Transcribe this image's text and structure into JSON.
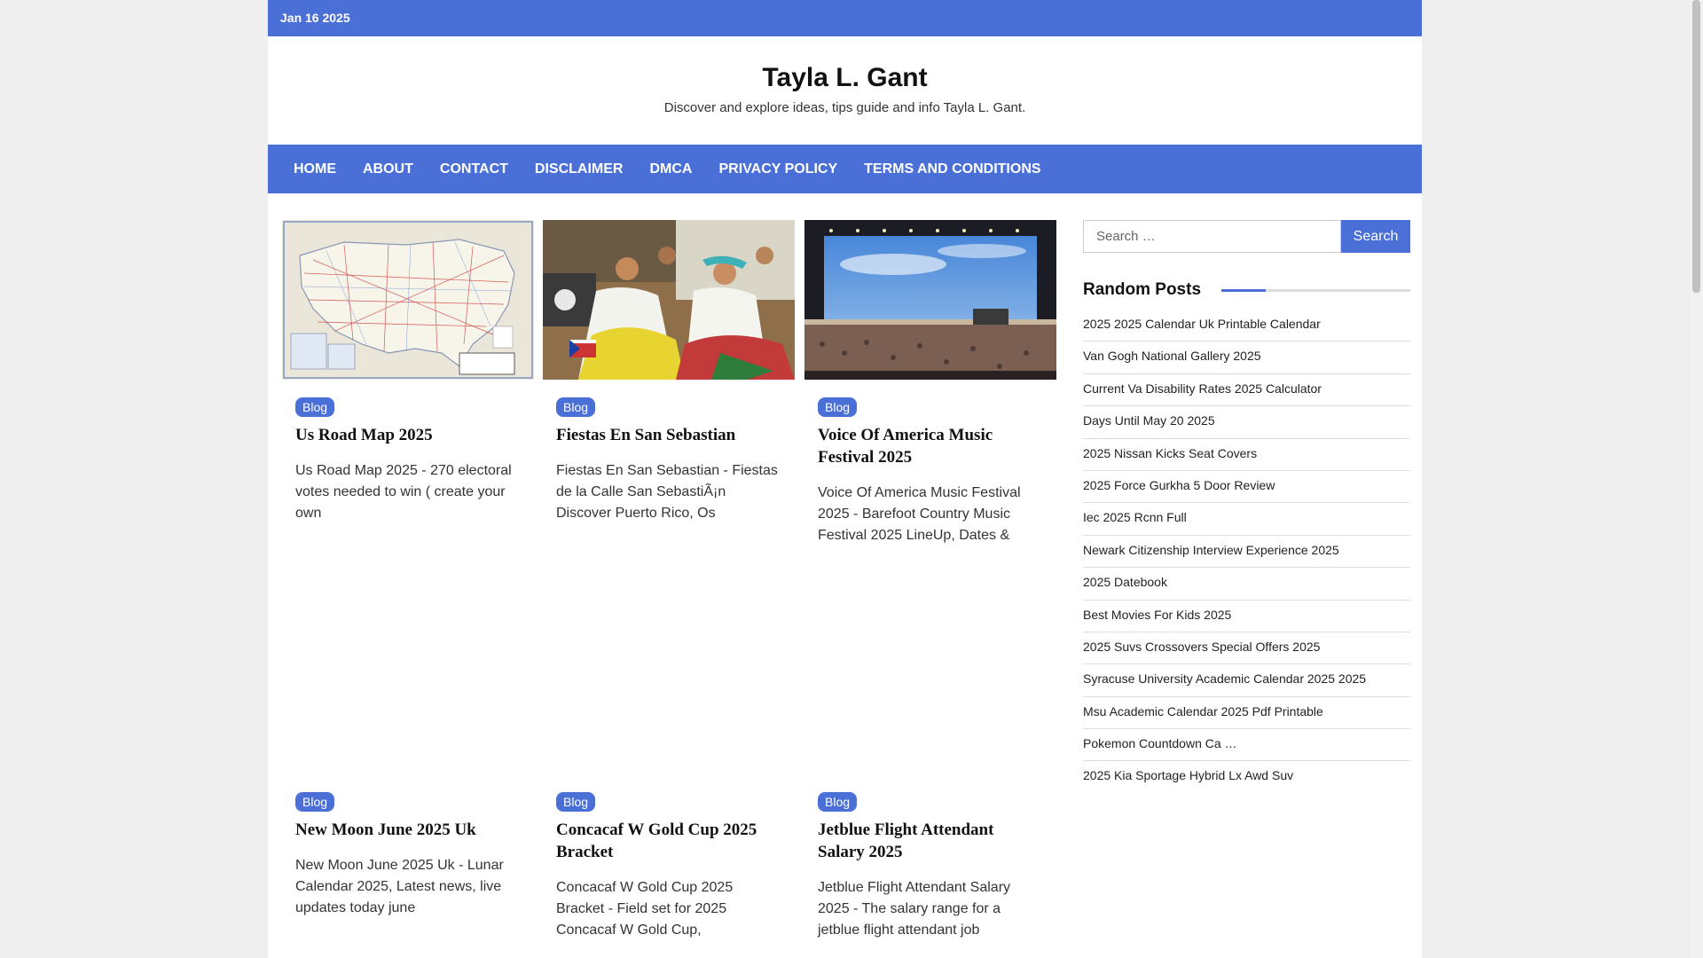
{
  "topbar": {
    "date": "Jan 16 2025"
  },
  "header": {
    "site_title": "Tayla L. Gant",
    "tagline": "Discover and explore ideas, tips guide and info Tayla L. Gant."
  },
  "nav": {
    "items": [
      "HOME",
      "ABOUT",
      "CONTACT",
      "DISCLAIMER",
      "DMCA",
      "PRIVACY POLICY",
      "TERMS AND CONDITIONS"
    ]
  },
  "posts": [
    {
      "category": "Blog",
      "title": "Us Road Map 2025",
      "excerpt": "Us Road Map 2025 - 270 electoral votes needed to win ( create your own",
      "image": "usa-road-map-image"
    },
    {
      "category": "Blog",
      "title": "Fiestas En San Sebastian",
      "excerpt": "Fiestas En San Sebastian - Fiestas de la Calle San SebastiÃ¡n Discover Puerto Rico, Os",
      "image": "festival-dancers-image"
    },
    {
      "category": "Blog",
      "title": "Voice Of America Music Festival 2025",
      "excerpt": "Voice Of America Music Festival 2025 - Barefoot Country Music Festival 2025 LineUp, Dates &",
      "image": "concert-crowd-image"
    },
    {
      "category": "Blog",
      "title": "New Moon June 2025 Uk",
      "excerpt": "New Moon June 2025 Uk - Lunar Calendar 2025, Latest news, live updates today june"
    },
    {
      "category": "Blog",
      "title": "Concacaf W Gold Cup 2025 Bracket",
      "excerpt": "Concacaf W Gold Cup 2025 Bracket - Field set for 2025 Concacaf W Gold Cup,"
    },
    {
      "category": "Blog",
      "title": "Jetblue Flight Attendant Salary 2025",
      "excerpt": "Jetblue Flight Attendant Salary 2025 - The salary range for a jetblue flight attendant job"
    }
  ],
  "sidebar": {
    "search": {
      "placeholder": "Search …",
      "button_label": "Search"
    },
    "random_posts": {
      "title": "Random Posts",
      "items": [
        "2025 2025 Calendar Uk Printable Calendar",
        "Van Gogh National Gallery 2025",
        "Current Va Disability Rates 2025 Calculator",
        "Days Until May 20 2025",
        "2025 Nissan Kicks Seat Covers",
        "2025 Force Gurkha 5 Door Review",
        "Iec 2025 Rcnn Full",
        "Newark Citizenship Interview Experience 2025",
        "2025 Datebook",
        "Best Movies For Kids 2025",
        "2025 Suvs Crossovers Special Offers 2025",
        "Syracuse University Academic Calendar 2025 2025",
        "Msu Academic Calendar 2025 Pdf Printable",
        "Pokemon Countdown Ca …",
        "2025 Kia Sportage Hybrid Lx Awd Suv"
      ]
    }
  },
  "colors": {
    "accent": "#4a6fd6",
    "background": "#efefef"
  }
}
